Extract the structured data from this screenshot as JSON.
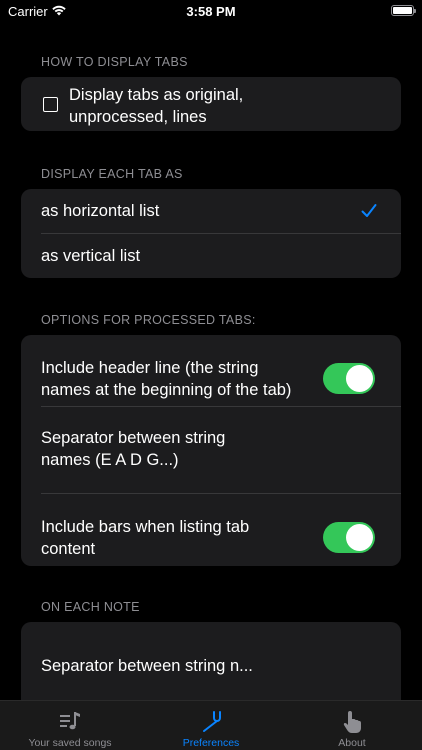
{
  "status_bar": {
    "carrier": "Carrier",
    "time": "3:58 PM"
  },
  "sections": {
    "display_tabs": {
      "header": "HOW TO DISPLAY TABS",
      "checkbox_label": "Display tabs as original, unprocessed, lines",
      "checked": false
    },
    "each_tab": {
      "header": "DISPLAY EACH TAB AS",
      "options": [
        "as horizontal list",
        "as vertical list"
      ],
      "selected": "as horizontal list"
    },
    "processed": {
      "header": "OPTIONS FOR PROCESSED TABS:",
      "include_header_label": "Include header line (the string names at the beginning of the tab)",
      "include_header_on": true,
      "separator_label": "Separator between string names (E A D G...)",
      "include_bars_label": "Include bars when listing tab content",
      "include_bars_on": true
    },
    "each_note": {
      "header": "ON EACH NOTE",
      "separator_label": "Separator between string n..."
    }
  },
  "tab_bar": {
    "items": [
      {
        "label": "Your saved songs",
        "icon": "music-list-icon",
        "active": false
      },
      {
        "label": "Preferences",
        "icon": "tuning-fork-icon",
        "active": true
      },
      {
        "label": "About",
        "icon": "hand-pointer-icon",
        "active": false
      }
    ]
  },
  "colors": {
    "accent": "#0a84ff",
    "toggle_on": "#34c759",
    "group_bg": "#1c1c1e",
    "header_text": "#8e8e93"
  }
}
